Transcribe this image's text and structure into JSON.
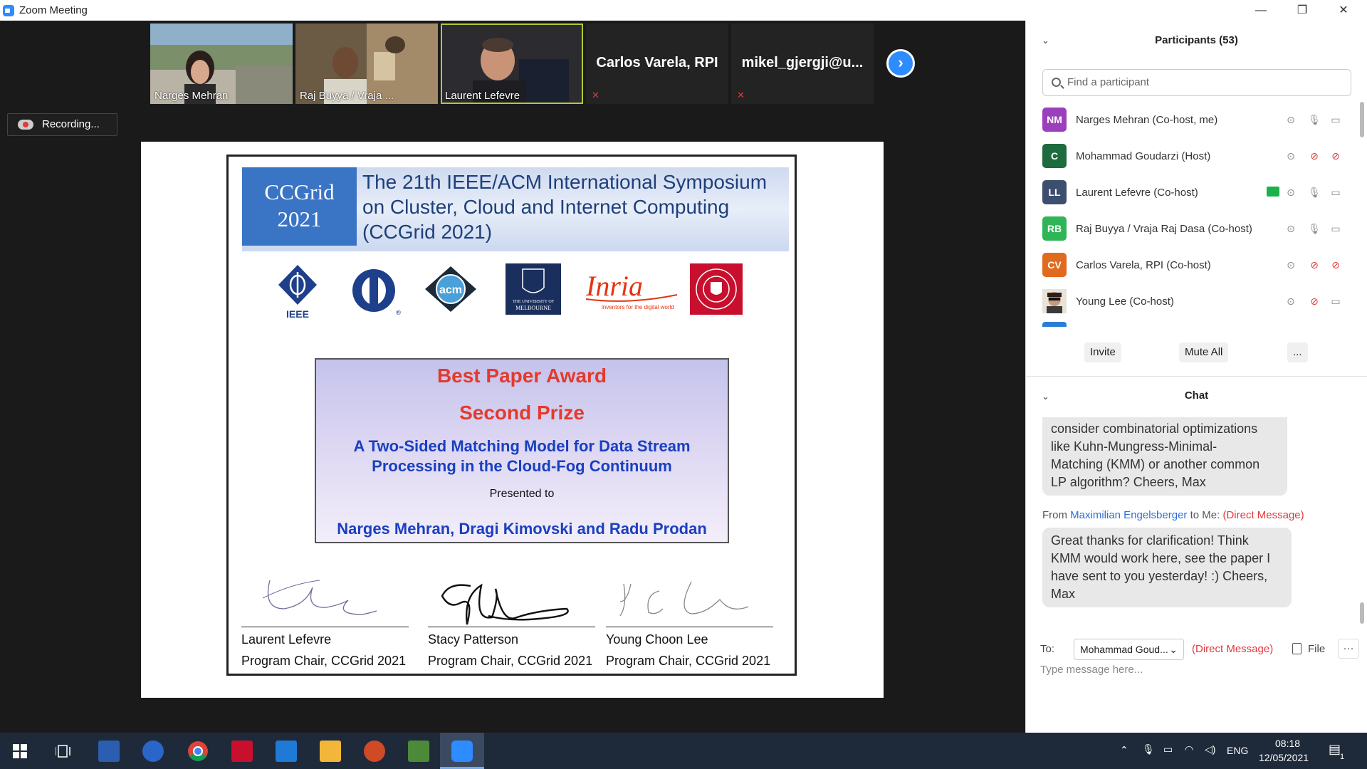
{
  "window": {
    "title": "Zoom Meeting",
    "minimize": "—",
    "restore": "❐",
    "close": "✕"
  },
  "video_strip": {
    "tiles": [
      {
        "name": "Narges Mehran"
      },
      {
        "name": "Raj Buyya / Vraja ..."
      },
      {
        "name": "Laurent Lefevre"
      },
      {
        "name": "Carlos Varela, RPI"
      },
      {
        "name": "mikel_gjergji@u..."
      }
    ],
    "next_arrow": "›"
  },
  "recording": {
    "label": "Recording..."
  },
  "slide": {
    "banner_logo_line1": "CCGrid",
    "banner_logo_line2": "2021",
    "banner_title_line1": "The 21th IEEE/ACM International Symposium",
    "banner_title_line2": "on Cluster, Cloud and Internet Computing",
    "banner_title_line3": "(CCGrid 2021)",
    "logos": {
      "ieee": "IEEE",
      "acm": "acm",
      "melbourne_line1": "THE UNIVERSITY OF",
      "melbourne_line2": "MELBOURNE",
      "inria": "Inria",
      "inria_tag": "inventors for the digital world"
    },
    "award_title": "Best Paper Award",
    "award_prize": "Second Prize",
    "paper_line1": "A Two-Sided Matching Model for Data Stream",
    "paper_line2": "Processing in the Cloud-Fog Continuum",
    "presented_to": "Presented to",
    "recipients": "Narges Mehran, Dragi Kimovski and Radu Prodan",
    "signatures": [
      {
        "name": "Laurent Lefevre",
        "role": "Program Chair, CCGrid 2021"
      },
      {
        "name": "Stacy Patterson",
        "role": "Program Chair, CCGrid 2021"
      },
      {
        "name": "Young Choon Lee",
        "role": "Program Chair, CCGrid 2021"
      }
    ]
  },
  "participants": {
    "header": "Participants (53)",
    "search_placeholder": "Find a participant",
    "list": [
      {
        "initials": "NM",
        "name": "Narges Mehran (Co-host, me)",
        "color": "#9b3fbd",
        "mic_muted": false,
        "video_off": false
      },
      {
        "initials": "C",
        "name": "Mohammad Goudarzi (Host)",
        "color": "#1d6b3e",
        "mic_muted": true,
        "video_off": true
      },
      {
        "initials": "LL",
        "name": "Laurent Lefevre (Co-host)",
        "color": "#3c4f6e",
        "mic_muted": false,
        "video_off": false,
        "sharing": true
      },
      {
        "initials": "RB",
        "name": "Raj Buyya / Vraja Raj Dasa (Co-host)",
        "color": "#2fb458",
        "mic_muted": false,
        "video_off": false
      },
      {
        "initials": "CV",
        "name": "Carlos Varela, RPI (Co-host)",
        "color": "#e06a1e",
        "mic_muted": true,
        "video_off": true
      },
      {
        "initials": "",
        "name": "Young Lee (Co-host)",
        "color": "#6a7a7a",
        "mic_muted": true,
        "video_off": false
      }
    ],
    "invite": "Invite",
    "mute_all": "Mute All",
    "more": "..."
  },
  "chat": {
    "header": "Chat",
    "messages": [
      {
        "text_lines": [
          "consider combinatorial optimizations",
          "like Kuhn-Mungress-Minimal-",
          "Matching (KMM) or another common",
          "LP algorithm? Cheers, Max"
        ]
      },
      {
        "from_prefix": "From",
        "from": "Maximilian Engelsberger",
        "to": "to Me:",
        "tag": "(Direct Message)",
        "text_lines": [
          "Great thanks for clarification! Think",
          "KMM would work here, see the paper I",
          "have sent to you yesterday! :) Cheers,",
          "Max"
        ]
      }
    ],
    "to_label": "To:",
    "to_value": "Mohammad Goud...",
    "to_tag": "(Direct Message)",
    "file": "File",
    "more": "···",
    "input_placeholder": "Type message here..."
  },
  "taskbar": {
    "time": "08:18",
    "date": "12/05/2021",
    "lang": "ENG",
    "notif_count": "1"
  }
}
